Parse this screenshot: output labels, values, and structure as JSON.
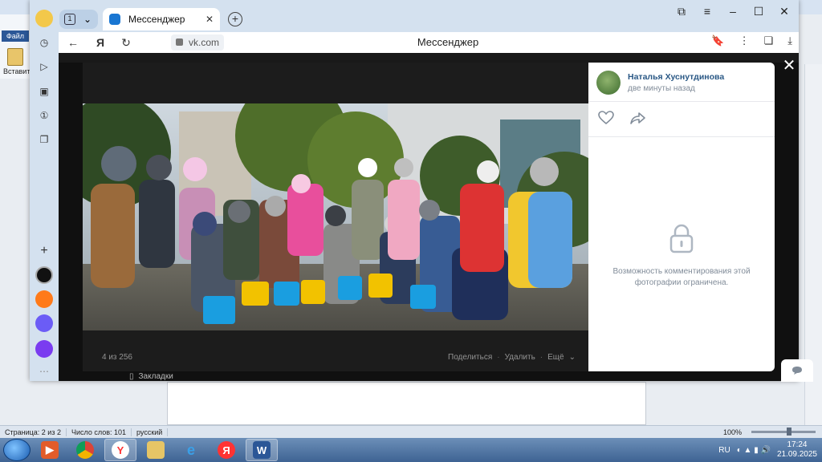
{
  "word": {
    "file_tab": "Файл",
    "paste_label": "Вставит",
    "status": {
      "page": "Страница: 2 из 2",
      "words": "Число слов: 101",
      "lang": "русский",
      "zoom": "100%"
    }
  },
  "browser": {
    "tab_count": "1",
    "tab_title": "Мессенджер",
    "url_domain": "vk.com",
    "page_title": "Мессенджер"
  },
  "viewer": {
    "counter": "4 из 256",
    "actions": {
      "share": "Поделиться",
      "delete": "Удалить",
      "more": "Ещё"
    },
    "bookmarks": "Закладки"
  },
  "panel": {
    "author": "Наталья Хуснутдинова",
    "time": "две минуты назад",
    "restriction": "Возможность комментирования этой фотографии ограничена."
  },
  "taskbar": {
    "lang": "RU",
    "time": "17:24",
    "date": "21.09.2025"
  }
}
